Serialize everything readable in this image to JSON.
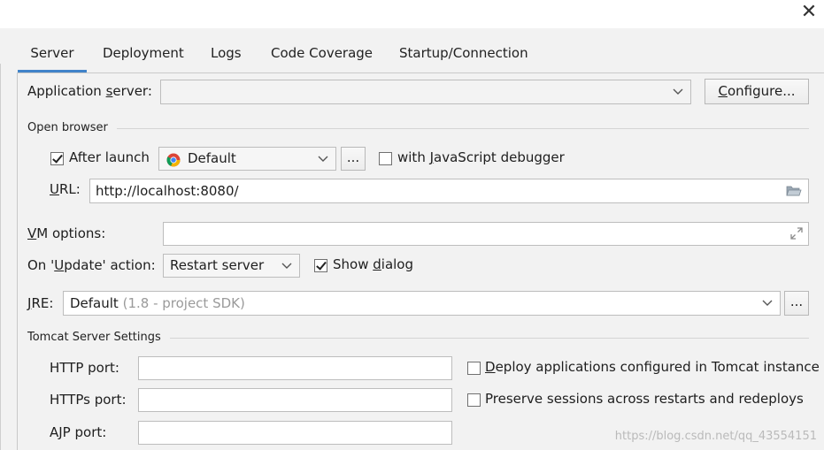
{
  "window": {
    "close_glyph": "✕"
  },
  "tabs": [
    {
      "label": "Server"
    },
    {
      "label": "Deployment"
    },
    {
      "label": "Logs"
    },
    {
      "label": "Code Coverage"
    },
    {
      "label": "Startup/Connection"
    }
  ],
  "app_server": {
    "label_pre": "Application ",
    "label_mnemonic": "s",
    "label_post": "erver:",
    "value": "",
    "configure_mnemonic": "C",
    "configure_rest": "onfigure..."
  },
  "open_browser": {
    "section_label": "Open browser",
    "after_launch_label": "After launch",
    "after_launch_checked": true,
    "browser_value": "Default",
    "browse_button": "...",
    "js_debugger_pre": "with ",
    "js_debugger_mnemonic": "J",
    "js_debugger_post": "avaScript debugger",
    "js_debugger_checked": false,
    "url_label_mnemonic": "U",
    "url_label_rest": "RL:",
    "url_value": "http://localhost:8080/"
  },
  "vm_options": {
    "label_mnemonic": "V",
    "label_rest": "M options:",
    "value": ""
  },
  "update_action": {
    "label_pre": "On '",
    "label_mnemonic": "U",
    "label_post": "pdate' action:",
    "value": "Restart server",
    "show_dialog_pre": "Show ",
    "show_dialog_mnemonic": "d",
    "show_dialog_post": "ialog",
    "show_dialog_checked": true
  },
  "jre": {
    "label_mnemonic": "J",
    "label_rest": "RE:",
    "value": "Default",
    "value_hint": "(1.8 - project SDK)",
    "browse_button": "..."
  },
  "tomcat": {
    "section_label": "Tomcat Server Settings",
    "http_port_label": "HTTP port:",
    "http_port_value": "",
    "https_port_label": "HTTPs port:",
    "https_port_value": "",
    "ajp_port_label": "AJP port:",
    "ajp_port_value": "",
    "deploy_pre": "",
    "deploy_mnemonic": "D",
    "deploy_post": "eploy applications configured in Tomcat instance",
    "deploy_checked": false,
    "preserve_label": "Preserve sessions across restarts and redeploys",
    "preserve_checked": false
  },
  "watermark": "https://blog.csdn.net/qq_43554151",
  "colors": {
    "accent": "#4083c9",
    "panel_bg": "#f2f2f2",
    "field_bg": "#ffffff"
  }
}
